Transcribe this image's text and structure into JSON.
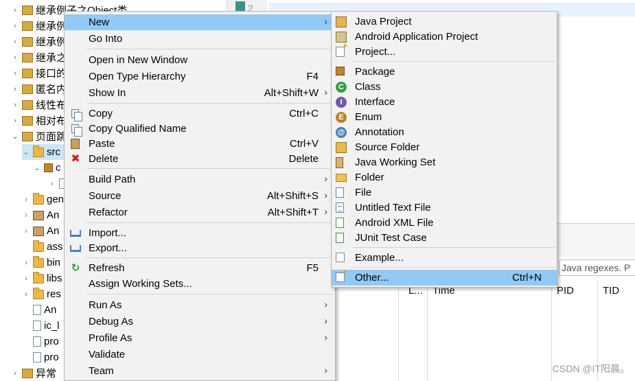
{
  "explorer": {
    "rows": [
      {
        "label": "继承例子之Object类"
      },
      {
        "label": "继承例"
      },
      {
        "label": "继承例"
      },
      {
        "label": "继承之"
      },
      {
        "label": "接口的"
      },
      {
        "label": "匿名内"
      },
      {
        "label": "线性布"
      },
      {
        "label": "相对布"
      },
      {
        "label": "页面跳"
      },
      {
        "label": "src"
      },
      {
        "label": "c"
      },
      {
        "label": ""
      },
      {
        "label": "gen"
      },
      {
        "label": "An"
      },
      {
        "label": "An"
      },
      {
        "label": "ass"
      },
      {
        "label": "bin"
      },
      {
        "label": "libs"
      },
      {
        "label": "res"
      },
      {
        "label": "An"
      },
      {
        "label": "ic_l"
      },
      {
        "label": "pro"
      },
      {
        "label": "pro"
      },
      {
        "label": "异常"
      }
    ]
  },
  "editor": {
    "line_number": "2"
  },
  "console": {
    "filter_text": "Java regexes. P",
    "columns": [
      "L...",
      "Time",
      "PID",
      "TID"
    ]
  },
  "watermark": "CSDN @IT阳晨。",
  "main_menu": {
    "items": [
      {
        "label": "New",
        "accel": "",
        "arrow": "›"
      },
      {
        "label": "Go Into",
        "accel": "",
        "arrow": ""
      },
      {
        "label": "Open in New Window",
        "accel": "",
        "arrow": ""
      },
      {
        "label": "Open Type Hierarchy",
        "accel": "F4",
        "arrow": ""
      },
      {
        "label": "Show In",
        "accel": "Alt+Shift+W",
        "arrow": "›"
      },
      {
        "label": "Copy",
        "accel": "Ctrl+C",
        "arrow": ""
      },
      {
        "label": "Copy Qualified Name",
        "accel": "",
        "arrow": ""
      },
      {
        "label": "Paste",
        "accel": "Ctrl+V",
        "arrow": ""
      },
      {
        "label": "Delete",
        "accel": "Delete",
        "arrow": ""
      },
      {
        "label": "Build Path",
        "accel": "",
        "arrow": "›"
      },
      {
        "label": "Source",
        "accel": "Alt+Shift+S",
        "arrow": "›"
      },
      {
        "label": "Refactor",
        "accel": "Alt+Shift+T",
        "arrow": "›"
      },
      {
        "label": "Import...",
        "accel": "",
        "arrow": ""
      },
      {
        "label": "Export...",
        "accel": "",
        "arrow": ""
      },
      {
        "label": "Refresh",
        "accel": "F5",
        "arrow": ""
      },
      {
        "label": "Assign Working Sets...",
        "accel": "",
        "arrow": ""
      },
      {
        "label": "Run As",
        "accel": "",
        "arrow": "›"
      },
      {
        "label": "Debug As",
        "accel": "",
        "arrow": "›"
      },
      {
        "label": "Profile As",
        "accel": "",
        "arrow": "›"
      },
      {
        "label": "Validate",
        "accel": "",
        "arrow": ""
      },
      {
        "label": "Team",
        "accel": "",
        "arrow": "›"
      }
    ]
  },
  "sub_menu": {
    "items": [
      {
        "label": "Java Project",
        "accel": ""
      },
      {
        "label": "Android Application Project",
        "accel": ""
      },
      {
        "label": "Project...",
        "accel": ""
      },
      {
        "label": "Package",
        "accel": ""
      },
      {
        "label": "Class",
        "accel": ""
      },
      {
        "label": "Interface",
        "accel": ""
      },
      {
        "label": "Enum",
        "accel": ""
      },
      {
        "label": "Annotation",
        "accel": ""
      },
      {
        "label": "Source Folder",
        "accel": ""
      },
      {
        "label": "Java Working Set",
        "accel": ""
      },
      {
        "label": "Folder",
        "accel": ""
      },
      {
        "label": "File",
        "accel": ""
      },
      {
        "label": "Untitled Text File",
        "accel": ""
      },
      {
        "label": "Android XML File",
        "accel": ""
      },
      {
        "label": "JUnit Test Case",
        "accel": ""
      },
      {
        "label": "Example...",
        "accel": ""
      },
      {
        "label": "Other...",
        "accel": "Ctrl+N"
      }
    ]
  }
}
